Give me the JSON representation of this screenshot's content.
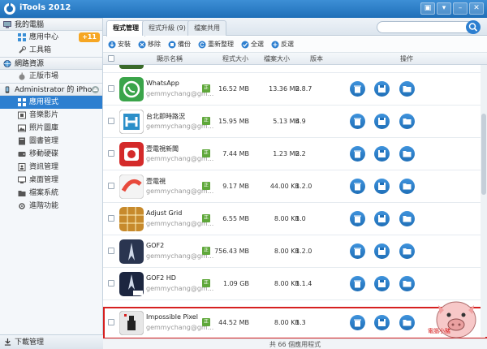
{
  "window": {
    "title": "iTools 2012"
  },
  "sidebar": {
    "sections": [
      {
        "label": "我的電腦",
        "items": [
          {
            "label": "應用中心",
            "badge": "+11"
          },
          {
            "label": "工具箱"
          }
        ]
      },
      {
        "label": "網路資源",
        "items": [
          {
            "label": "正版市場"
          }
        ]
      },
      {
        "label": "Administrator 的 iPho...",
        "items": [
          {
            "label": "應用程式",
            "selected": true
          },
          {
            "label": "音樂影片"
          },
          {
            "label": "照片圖庫"
          },
          {
            "label": "圖書管理"
          },
          {
            "label": "移動硬碟"
          },
          {
            "label": "資訊管理"
          },
          {
            "label": "桌面管理"
          },
          {
            "label": "檔案系統"
          },
          {
            "label": "進階功能"
          }
        ]
      }
    ],
    "download": "下載管理"
  },
  "tabs": [
    {
      "label": "程式管理",
      "active": true
    },
    {
      "label": "程式升級 (9)"
    },
    {
      "label": "檔案共用"
    }
  ],
  "search": {
    "placeholder": ""
  },
  "toolbar": [
    "安裝",
    "移除",
    "備份",
    "重新整理",
    "全選",
    "反選"
  ],
  "table": {
    "headers": [
      "顯示名稱",
      "程式大小",
      "檔案大小",
      "版本",
      "操作"
    ],
    "rows": [
      {
        "name": "WhatsApp",
        "email": "gemmychang@gm...",
        "tag": "正",
        "app_size": "16.52 MB",
        "file_size": "13.36 MB",
        "version": "2.8.7",
        "color": "#3aa44a"
      },
      {
        "name": "台北即時路況",
        "email": "gemmychang@gm...",
        "tag": "正",
        "app_size": "15.95 MB",
        "file_size": "5.13 MB",
        "version": "4.9",
        "color": "#2b8fc9"
      },
      {
        "name": "壹電視新聞",
        "email": "gemmychang@gm...",
        "tag": "正",
        "app_size": "7.44 MB",
        "file_size": "1.23 MB",
        "version": "2.2",
        "color": "#d42a2a"
      },
      {
        "name": "壹電視",
        "email": "gemmychang@gm...",
        "tag": "正",
        "app_size": "9.17 MB",
        "file_size": "44.00 KB",
        "version": "1.2.0",
        "color": "#e84a3c"
      },
      {
        "name": "Adjust Grid",
        "email": "gemmychang@gm...",
        "tag": "正",
        "app_size": "6.55 MB",
        "file_size": "8.00 KB",
        "version": "1.0",
        "color": "#c78a2c"
      },
      {
        "name": "GOF2",
        "email": "gemmychang@gm...",
        "tag": "正",
        "app_size": "756.43 MB",
        "file_size": "8.00 KB",
        "version": "1.2.0",
        "color": "#2a3550"
      },
      {
        "name": "GOF2 HD",
        "email": "gemmychang@gm...",
        "tag": "正",
        "app_size": "1.09 GB",
        "file_size": "8.00 KB",
        "version": "1.1.4",
        "color": "#1c2640"
      },
      {
        "name": "Impossible Pixel",
        "email": "gemmychang@gm...",
        "tag": "正",
        "app_size": "44.52 MB",
        "file_size": "8.00 KB",
        "version": "1.3",
        "color": "#e7e7e7",
        "highlighted": true
      }
    ]
  },
  "footer": "共 66 個應用程式",
  "watermark": "電腦小豬"
}
